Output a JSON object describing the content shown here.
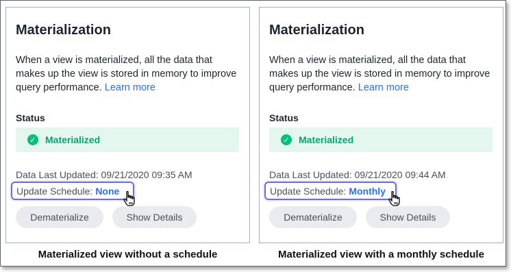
{
  "panels": [
    {
      "title": "Materialization",
      "description": "When a view is materialized, all the data that makes up the view is stored in memory to improve query performance.",
      "learn_more": "Learn more",
      "status_label": "Status",
      "status_value": "Materialized",
      "status_icon": "check-circle-icon",
      "last_updated": "Data Last Updated: 09/21/2020 09:35 AM",
      "schedule_label": "Update Schedule:",
      "schedule_value": "None",
      "dematerialize_label": "Dematerialize",
      "show_details_label": "Show Details",
      "caption": "Materialized view without a schedule"
    },
    {
      "title": "Materialization",
      "description": "When a view is materialized, all the data that makes up the view is stored in memory to improve query performance.",
      "learn_more": "Learn more",
      "status_label": "Status",
      "status_value": "Materialized",
      "status_icon": "check-circle-icon",
      "last_updated": "Data Last Updated: 09/21/2020 09:44 AM",
      "schedule_label": "Update Schedule:",
      "schedule_value": "Monthly",
      "dematerialize_label": "Dematerialize",
      "show_details_label": "Show Details",
      "caption": "Materialized view with a monthly schedule"
    }
  ],
  "colors": {
    "accent_link": "#2770ef",
    "status_bg": "#e3f7ee",
    "status_text": "#06a56e",
    "highlight_border": "#6870e0"
  }
}
